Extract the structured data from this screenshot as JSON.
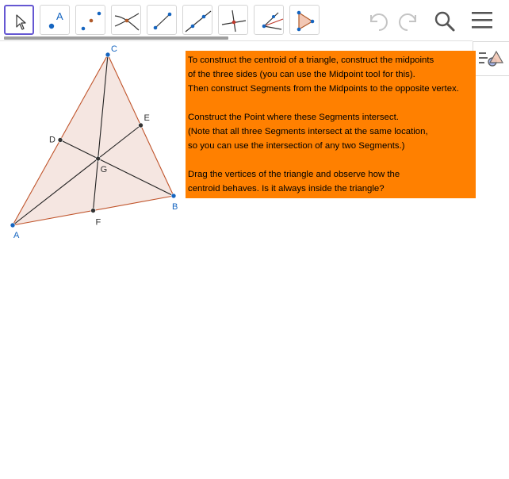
{
  "toolbar": {
    "tools": [
      {
        "id": "move",
        "selected": true,
        "icon": "move-cursor-icon"
      },
      {
        "id": "point",
        "selected": false,
        "icon": "point-icon",
        "glyph": "A"
      },
      {
        "id": "midpoint",
        "selected": false,
        "icon": "midpoint-icon"
      },
      {
        "id": "intersect",
        "selected": false,
        "icon": "intersect-icon"
      },
      {
        "id": "segment",
        "selected": false,
        "icon": "segment-icon"
      },
      {
        "id": "line",
        "selected": false,
        "icon": "line-icon"
      },
      {
        "id": "perpendicular",
        "selected": false,
        "icon": "perpendicular-line-icon"
      },
      {
        "id": "angle-bisector",
        "selected": false,
        "icon": "angle-bisector-icon"
      },
      {
        "id": "polygon",
        "selected": false,
        "icon": "polygon-icon"
      }
    ],
    "actions": [
      "undo-icon",
      "redo-icon",
      "search-icon",
      "menu-icon"
    ]
  },
  "algebra_toggle": {
    "icon": "algebra-view-icon"
  },
  "construction": {
    "points": [
      {
        "label": "A",
        "color": "#1565c0"
      },
      {
        "label": "B",
        "color": "#1565c0"
      },
      {
        "label": "C",
        "color": "#1565c0"
      },
      {
        "label": "D",
        "color": "#333333"
      },
      {
        "label": "E",
        "color": "#333333"
      },
      {
        "label": "F",
        "color": "#333333"
      },
      {
        "label": "G",
        "color": "#333333"
      }
    ],
    "colors": {
      "triangle_fill": "#f5e6e1",
      "triangle_edge": "#c0542b",
      "median": "#222222",
      "vertex_point": "#1565c0",
      "derived_point": "#333333"
    }
  },
  "instructions": {
    "background": "#ff8000",
    "lines": [
      "To construct the centroid of a triangle, construct the midpoints",
      "of the three sides (you can use the Midpoint tool for this).",
      "Then construct Segments from the Midpoints to the opposite vertex.",
      "",
      "Construct the Point where these Segments intersect.",
      "(Note that all three Segments intersect at the same location,",
      "so you can use the intersection of any two Segments.)",
      "",
      "Drag the vertices of the triangle and observe how the",
      "centroid behaves. Is it always inside the triangle?"
    ]
  }
}
